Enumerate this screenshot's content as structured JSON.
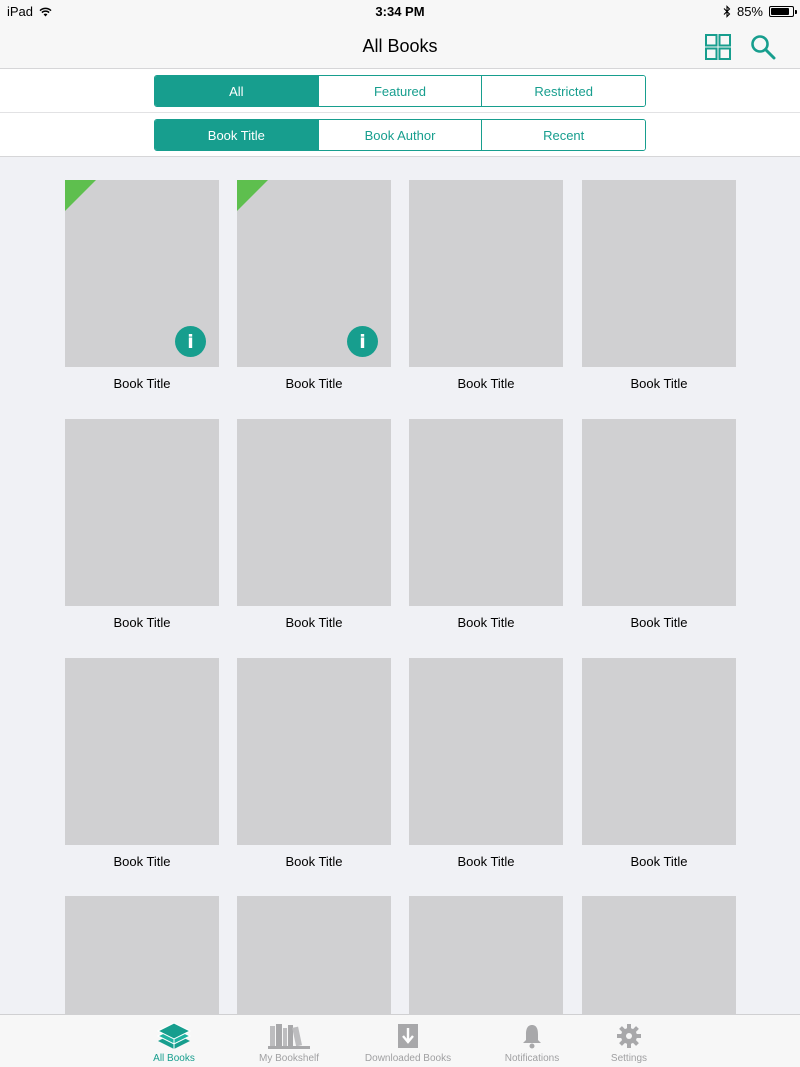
{
  "status_bar": {
    "device": "iPad",
    "time": "3:34 PM",
    "battery": "85%",
    "battery_level": 0.85
  },
  "nav": {
    "title": "All Books",
    "grid_icon": "grid-view-icon",
    "search_icon": "search-icon"
  },
  "filter_segments": {
    "items": [
      "All",
      "Featured",
      "Restricted"
    ],
    "selected": "All"
  },
  "sort_segments": {
    "items": [
      "Book Title",
      "Book Author",
      "Recent"
    ],
    "selected": "Book Title"
  },
  "books": [
    {
      "title": "Book Title",
      "new_marker": true,
      "info": "i"
    },
    {
      "title": "Book Title",
      "new_marker": true,
      "info": "i"
    },
    {
      "title": "Book Title"
    },
    {
      "title": "Book Title"
    },
    {
      "title": "Book Title"
    },
    {
      "title": "Book Title"
    },
    {
      "title": "Book Title"
    },
    {
      "title": "Book Title"
    },
    {
      "title": "Book Title"
    },
    {
      "title": "Book Title"
    },
    {
      "title": "Book Title"
    },
    {
      "title": "Book Title"
    },
    {
      "title": ""
    },
    {
      "title": ""
    },
    {
      "title": ""
    },
    {
      "title": ""
    }
  ],
  "tab_bar": {
    "items": [
      {
        "label": "All Books",
        "icon": "books-stack-icon",
        "active": true
      },
      {
        "label": "My Bookshelf",
        "icon": "bookshelf-icon",
        "active": false
      },
      {
        "label": "Downloaded Books",
        "icon": "download-icon",
        "active": false
      },
      {
        "label": "Notifications",
        "icon": "bell-icon",
        "active": false
      },
      {
        "label": "Settings",
        "icon": "gear-icon",
        "active": false
      }
    ]
  },
  "colors": {
    "accent": "#179e8e",
    "new_marker": "#5ebf4e",
    "cover_placeholder": "#d0d0d2",
    "background": "#f0f1f5"
  }
}
